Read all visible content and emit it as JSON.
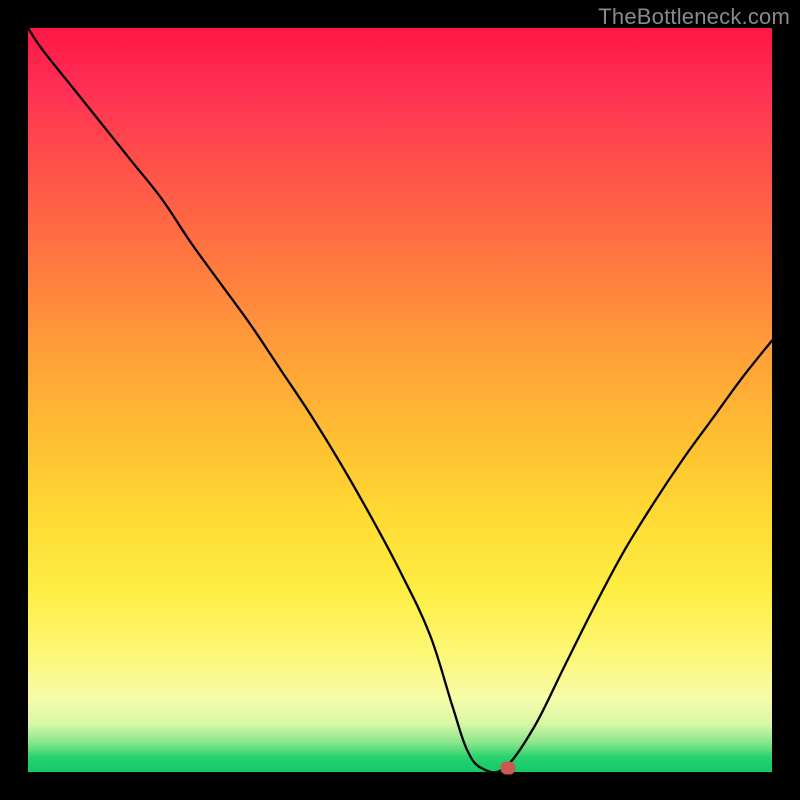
{
  "watermark": "TheBottleneck.com",
  "colors": {
    "frame": "#000000",
    "gradient_top": "#ff1744",
    "gradient_mid": "#ffd633",
    "gradient_bottom": "#13c96a",
    "curve": "#000000",
    "marker": "#c95a4e"
  },
  "chart_data": {
    "type": "line",
    "title": "",
    "xlabel": "",
    "ylabel": "",
    "xlim": [
      0,
      100
    ],
    "ylim": [
      0,
      100
    ],
    "x": [
      0,
      2,
      6,
      10,
      14,
      18,
      22,
      26,
      30,
      34,
      38,
      42,
      46,
      50,
      54,
      57,
      59,
      61,
      64,
      68,
      72,
      76,
      80,
      84,
      88,
      92,
      96,
      100
    ],
    "y": [
      100,
      97,
      92,
      87,
      82,
      77,
      71,
      65.5,
      60,
      54,
      48,
      41.5,
      34.5,
      27,
      18.5,
      9,
      3,
      0.5,
      0.5,
      6,
      14,
      22,
      29.5,
      36,
      42,
      47.5,
      53,
      58
    ],
    "flat_segment_x": [
      59,
      64
    ],
    "marker": {
      "x": 64.5,
      "y": 0.5
    },
    "note": "Values in percent of plot width/height; y measured upward from bottom edge of gradient area. Curve is a V-shaped bottleneck profile touching ~0 near x≈62."
  }
}
